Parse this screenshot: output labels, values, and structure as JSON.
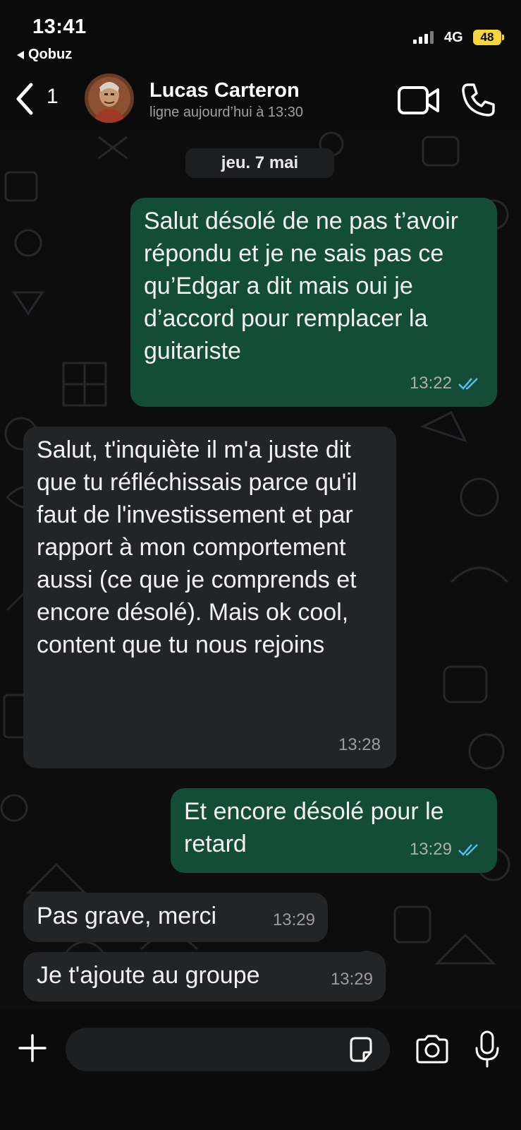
{
  "status_bar": {
    "time": "13:41",
    "back_app": "Qobuz",
    "network": "4G",
    "battery": "48"
  },
  "header": {
    "unread_count": "1",
    "contact_name": "Lucas Carteron",
    "contact_status": "ligne aujourd’hui à 13:30"
  },
  "chat": {
    "date_label": "jeu. 7 mai",
    "messages": [
      {
        "direction": "outgoing",
        "text": "Salut désolé de ne pas t’avoir répondu et je ne sais pas ce qu’Edgar a dit mais oui je d’accord pour remplacer la guitariste",
        "time": "13:22",
        "read": true
      },
      {
        "direction": "incoming",
        "text": "Salut, t'inquiète il m'a juste dit que tu réfléchissais parce qu'il faut de l'investissement et par rapport à mon comportement aussi (ce que je comprends et encore désolé). Mais ok cool, content que tu nous rejoins",
        "time": "13:28"
      },
      {
        "direction": "outgoing",
        "text": "Et encore désolé pour le retard",
        "time": "13:29",
        "read": true
      },
      {
        "direction": "incoming",
        "text": "Pas grave, merci",
        "time": "13:29"
      },
      {
        "direction": "incoming",
        "text": "Je t'ajoute au groupe",
        "time": "13:29"
      }
    ]
  },
  "input_bar": {
    "placeholder": ""
  },
  "colors": {
    "outgoing_bubble": "#144d37",
    "incoming_bubble": "#232426",
    "read_ticks": "#53bdeb",
    "battery": "#f5d53b"
  },
  "icons": [
    "back-chevron-icon",
    "video-call-icon",
    "phone-call-icon",
    "plus-icon",
    "sticker-icon",
    "camera-icon",
    "microphone-icon",
    "read-ticks-icon"
  ]
}
